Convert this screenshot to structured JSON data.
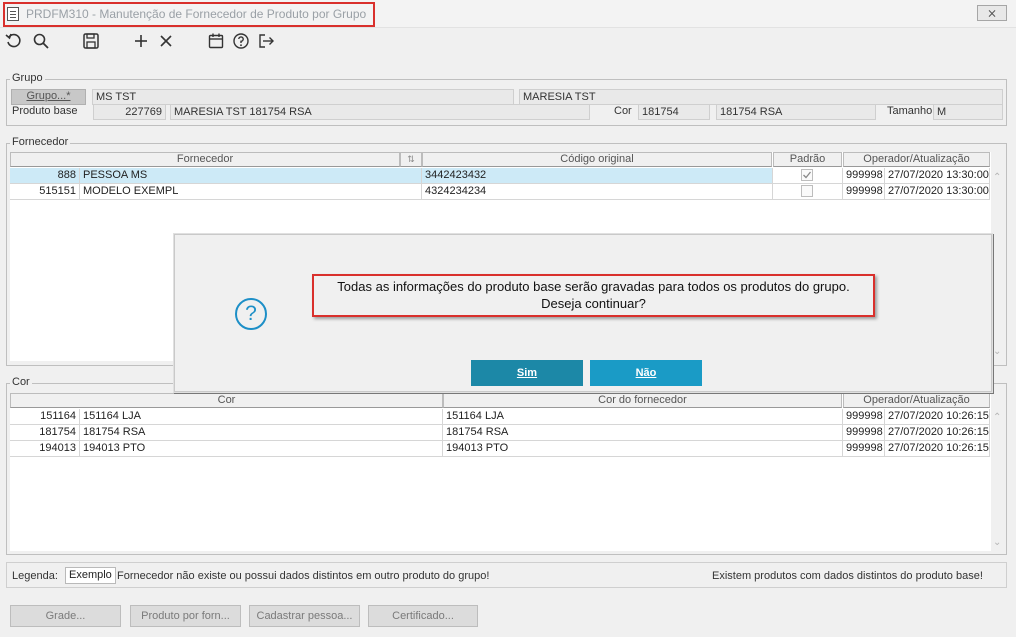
{
  "window": {
    "title": "PRDFM310 - Manutenção de Fornecedor de Produto por Grupo",
    "close_glyph": "⨯"
  },
  "toolbar": {
    "icons": [
      "undo-icon",
      "search-icon",
      "save-icon",
      "add-icon",
      "delete-icon",
      "calendar-icon",
      "help-icon",
      "exit-icon"
    ]
  },
  "grupo": {
    "legend": "Grupo",
    "grupo_button": "Grupo...*",
    "grupo_code": "MS TST",
    "grupo_desc": "MARESIA TST",
    "produto_base_label": "Produto base",
    "produto_base_code": "227769",
    "produto_base_desc": "MARESIA TST 181754 RSA",
    "cor_label": "Cor",
    "cor_code": "181754",
    "cor_desc": "181754 RSA",
    "tamanho_label": "Tamanho",
    "tamanho_value": "M"
  },
  "fornecedor": {
    "legend": "Fornecedor",
    "columns": [
      "Fornecedor",
      "Código original",
      "Padrão",
      "Operador/Atualização"
    ],
    "rows": [
      {
        "code": "888",
        "name": "PESSOA MS",
        "codigo_original": "3442423432",
        "padrao": true,
        "operador": "999998",
        "atualizacao": "27/07/2020 13:30:00"
      },
      {
        "code": "515151",
        "name": "MODELO EXEMPL",
        "codigo_original": "4324234234",
        "padrao": false,
        "operador": "999998",
        "atualizacao": "27/07/2020 13:30:00"
      }
    ]
  },
  "cor": {
    "legend": "Cor",
    "columns": [
      "Cor",
      "Cor do fornecedor",
      "Operador/Atualização"
    ],
    "rows": [
      {
        "code": "151164",
        "name": "151164 LJA",
        "cor_fornecedor": "151164 LJA",
        "operador": "999998",
        "atualizacao": "27/07/2020 10:26:15"
      },
      {
        "code": "181754",
        "name": "181754 RSA",
        "cor_fornecedor": "181754 RSA",
        "operador": "999998",
        "atualizacao": "27/07/2020 10:26:15"
      },
      {
        "code": "194013",
        "name": "194013 PTO",
        "cor_fornecedor": "194013 PTO",
        "operador": "999998",
        "atualizacao": "27/07/2020 10:26:15"
      }
    ]
  },
  "dialog": {
    "message_line1": "Todas as informações do produto base serão gravadas para todos os produtos do grupo.",
    "message_line2": "Deseja continuar?",
    "yes_label": "Sim",
    "no_label": "Não"
  },
  "legenda": {
    "label": "Legenda:",
    "example": "Exemplo",
    "note_left": "Fornecedor não existe ou possui dados distintos em outro produto do grupo!",
    "note_right": "Existem produtos com dados distintos do produto base!"
  },
  "bottom_buttons": {
    "grade": "Grade...",
    "produto_por_forn": "Produto por forn...",
    "cadastrar_pessoa": "Cadastrar pessoa...",
    "certificado": "Certificado..."
  },
  "colors": {
    "accent_highlight": "#d9302c",
    "button_sim": "#1c88a7",
    "button_nao": "#1a9bc6",
    "selected_row": "#cdeaf7",
    "question_icon": "#1d8fc7"
  }
}
